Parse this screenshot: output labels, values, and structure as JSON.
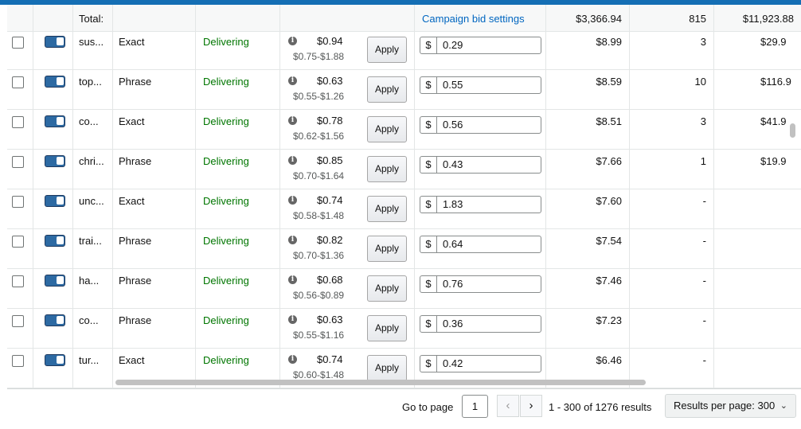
{
  "header": {
    "total_label": "Total:",
    "campaign_bid_settings": "Campaign bid settings",
    "total_spend": "$3,366.94",
    "total_orders": "815",
    "total_sales": "$11,923.88"
  },
  "rows": [
    {
      "keyword": "sus...",
      "match": "Exact",
      "status": "Delivering",
      "suggested": "$0.94",
      "range": "$0.75-$1.88",
      "apply": "Apply",
      "currency": "$",
      "bid": "0.29",
      "spend": "$8.99",
      "orders": "3",
      "sales": "$29.9"
    },
    {
      "keyword": "top...",
      "match": "Phrase",
      "status": "Delivering",
      "suggested": "$0.63",
      "range": "$0.55-$1.26",
      "apply": "Apply",
      "currency": "$",
      "bid": "0.55",
      "spend": "$8.59",
      "orders": "10",
      "sales": "$116.9"
    },
    {
      "keyword": "co...",
      "match": "Exact",
      "status": "Delivering",
      "suggested": "$0.78",
      "range": "$0.62-$1.56",
      "apply": "Apply",
      "currency": "$",
      "bid": "0.56",
      "spend": "$8.51",
      "orders": "3",
      "sales": "$41.9"
    },
    {
      "keyword": "chri...",
      "match": "Phrase",
      "status": "Delivering",
      "suggested": "$0.85",
      "range": "$0.70-$1.64",
      "apply": "Apply",
      "currency": "$",
      "bid": "0.43",
      "spend": "$7.66",
      "orders": "1",
      "sales": "$19.9"
    },
    {
      "keyword": "unc...",
      "match": "Exact",
      "status": "Delivering",
      "suggested": "$0.74",
      "range": "$0.58-$1.48",
      "apply": "Apply",
      "currency": "$",
      "bid": "1.83",
      "spend": "$7.60",
      "orders": "-",
      "sales": ""
    },
    {
      "keyword": "trai...",
      "match": "Phrase",
      "status": "Delivering",
      "suggested": "$0.82",
      "range": "$0.70-$1.36",
      "apply": "Apply",
      "currency": "$",
      "bid": "0.64",
      "spend": "$7.54",
      "orders": "-",
      "sales": ""
    },
    {
      "keyword": "ha...",
      "match": "Phrase",
      "status": "Delivering",
      "suggested": "$0.68",
      "range": "$0.56-$0.89",
      "apply": "Apply",
      "currency": "$",
      "bid": "0.76",
      "spend": "$7.46",
      "orders": "-",
      "sales": ""
    },
    {
      "keyword": "co...",
      "match": "Phrase",
      "status": "Delivering",
      "suggested": "$0.63",
      "range": "$0.55-$1.16",
      "apply": "Apply",
      "currency": "$",
      "bid": "0.36",
      "spend": "$7.23",
      "orders": "-",
      "sales": ""
    },
    {
      "keyword": "tur...",
      "match": "Exact",
      "status": "Delivering",
      "suggested": "$0.74",
      "range": "$0.60-$1.48",
      "apply": "Apply",
      "currency": "$",
      "bid": "0.42",
      "spend": "$6.46",
      "orders": "-",
      "sales": ""
    }
  ],
  "pagination": {
    "go_to_page_label": "Go to page",
    "current_page": "1",
    "prev_icon": "‹",
    "next_icon": "›",
    "results_text": "1 - 300 of 1276 results",
    "results_per_page": "Results per page: 300",
    "chevron_icon": "⌄"
  },
  "colors": {
    "accent": "#146eb4",
    "link": "#0066c0",
    "delivering": "#007600",
    "toggle": "#2d6aa3"
  }
}
